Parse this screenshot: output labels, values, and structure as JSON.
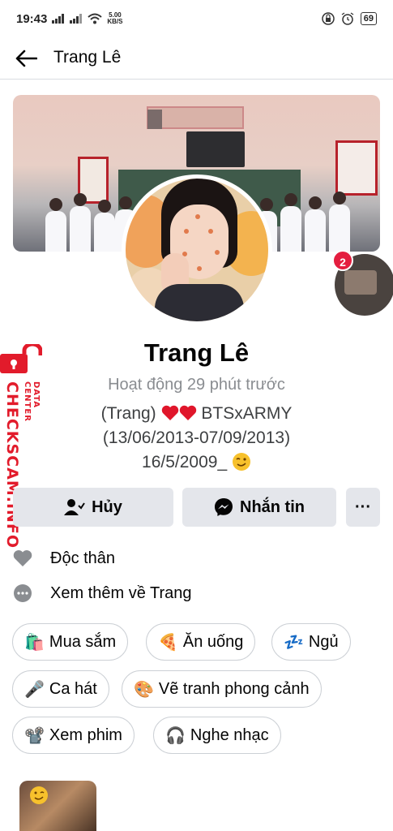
{
  "status_bar": {
    "time": "19:43",
    "net_speed_value": "5.00",
    "net_speed_unit": "KB/S",
    "battery": "69"
  },
  "header": {
    "title": "Trang Lê"
  },
  "profile": {
    "name": "Trang Lê",
    "active_status": "Hoạt động 29 phút trước",
    "bio_line1_prefix": "(Trang)",
    "bio_line1_suffix": "BTSxARMY",
    "bio_line2": "(13/06/2013-07/09/2013)",
    "bio_line3": "16/5/2009_",
    "story_count": "2"
  },
  "actions": {
    "cancel_label": "Hủy",
    "message_label": "Nhắn tin",
    "more_label": "···"
  },
  "info": {
    "relationship": "Độc thân",
    "see_more": "Xem thêm về Trang"
  },
  "interests": [
    {
      "emoji": "🛍️",
      "label": "Mua sắm"
    },
    {
      "emoji": "🍕",
      "label": "Ăn uống"
    },
    {
      "emoji": "💤",
      "label": "Ngủ"
    },
    {
      "emoji": "🎤",
      "label": "Ca hát"
    },
    {
      "emoji": "🎨",
      "label": "Vẽ tranh phong cảnh"
    },
    {
      "emoji": "📽️",
      "label": "Xem phim"
    },
    {
      "emoji": "🎧",
      "label": "Nghe nhạc"
    }
  ],
  "watermark": {
    "main": "CHECKSCAM.INFO",
    "sub": "DATA CENTER"
  },
  "colors": {
    "button_bg": "#e4e6eb",
    "secondary_text": "#8a8d91",
    "watermark_red": "#e21b2b",
    "badge_red": "#e41e3f"
  }
}
